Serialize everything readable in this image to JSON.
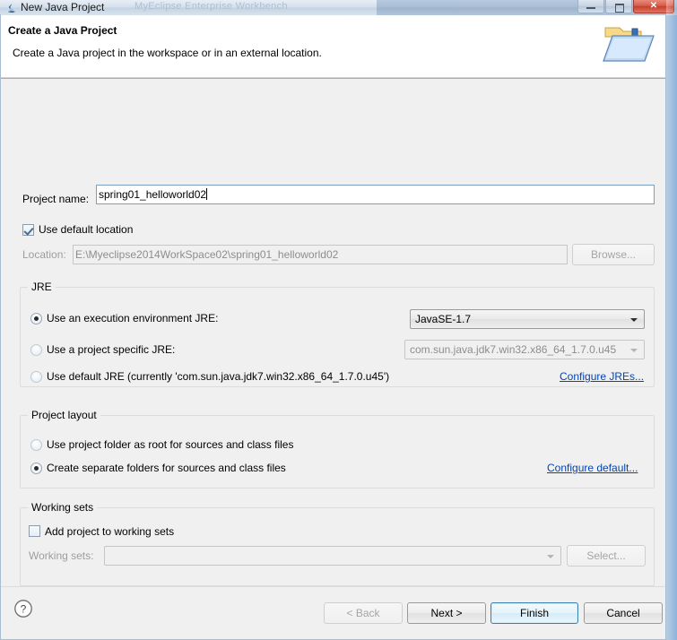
{
  "window": {
    "title": "New Java Project",
    "ghost_title": "MyEclipse Enterprise Workbench",
    "icon": "java-project-icon",
    "buttons": {
      "minimize": "minimize-button",
      "maximize": "maximize-button",
      "close": "✕"
    }
  },
  "header": {
    "title": "Create a Java Project",
    "description": "Create a Java project in the workspace or in an external location.",
    "icon": "new-java-project-folder-icon"
  },
  "project": {
    "name_label": "Project name:",
    "name_value": "spring01_helloworld02",
    "use_default_location_label": "Use default location",
    "use_default_location_checked": true,
    "location_label": "Location:",
    "location_value": "E:\\Myeclipse2014WorkSpace02\\spring01_helloworld02",
    "browse_label": "Browse..."
  },
  "jre": {
    "group_title": "JRE",
    "options": [
      {
        "label": "Use an execution environment JRE:",
        "selected": true
      },
      {
        "label": "Use a project specific JRE:",
        "selected": false
      },
      {
        "label": "Use default JRE (currently 'com.sun.java.jdk7.win32.x86_64_1.7.0.u45')",
        "selected": false
      }
    ],
    "environment_value": "JavaSE-1.7",
    "specific_jre_value": "com.sun.java.jdk7.win32.x86_64_1.7.0.u45",
    "configure_link": "Configure JREs..."
  },
  "layout": {
    "group_title": "Project layout",
    "options": [
      {
        "label": "Use project folder as root for sources and class files",
        "selected": false
      },
      {
        "label": "Create separate folders for sources and class files",
        "selected": true
      }
    ],
    "configure_link": "Configure default..."
  },
  "working_sets": {
    "group_title": "Working sets",
    "add_label": "Add project to working sets",
    "add_checked": false,
    "sets_label": "Working sets:",
    "sets_value": "",
    "select_label": "Select..."
  },
  "footer": {
    "help_icon": "help-question-icon",
    "back_label": "< Back",
    "next_label": "Next >",
    "finish_label": "Finish",
    "cancel_label": "Cancel"
  },
  "colors": {
    "accent_link": "#0645ad",
    "default_button_border": "#3c7fb1",
    "close_button": "#c4402c",
    "dialog_bg": "#f0f0f0"
  }
}
